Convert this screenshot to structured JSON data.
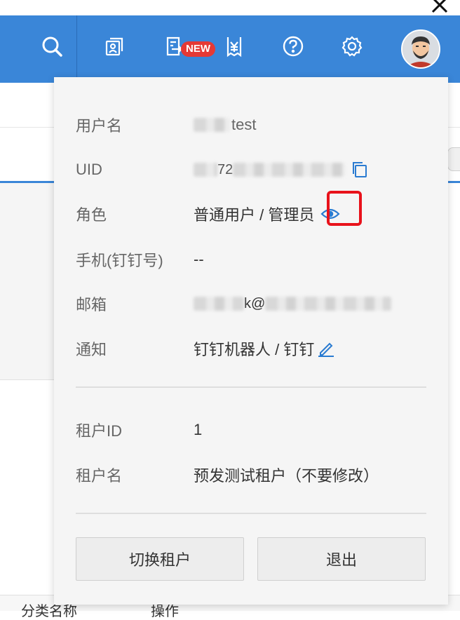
{
  "topbar": {
    "icons": [
      "search-icon",
      "id-card-icon",
      "invoice-icon",
      "yen-receipt-icon",
      "help-icon",
      "gear-icon"
    ],
    "new_badge": "NEW"
  },
  "profile": {
    "rows": [
      {
        "label": "用户名",
        "value": "test"
      },
      {
        "label": "UID",
        "value": "72"
      },
      {
        "label": "角色",
        "value": "普通用户 / 管理员"
      },
      {
        "label": "手机(钉钉号)",
        "value": "--"
      },
      {
        "label": "邮箱",
        "value": "k@"
      },
      {
        "label": "通知",
        "value": "钉钉机器人 / 钉钉"
      }
    ],
    "tenant_rows": [
      {
        "label": "租户ID",
        "value": "1"
      },
      {
        "label": "租户名",
        "value": "预发测试租户（不要修改）"
      }
    ],
    "switch_tenant_button": "切换租户",
    "logout_button": "退出"
  },
  "background": {
    "bottom_left_text": "分类名称",
    "bottom_right_text": "操作"
  },
  "colors": {
    "topbar": "#3a86d8",
    "badge": "#e53935",
    "highlight": "#e8121b",
    "link": "#2a7bd1"
  }
}
